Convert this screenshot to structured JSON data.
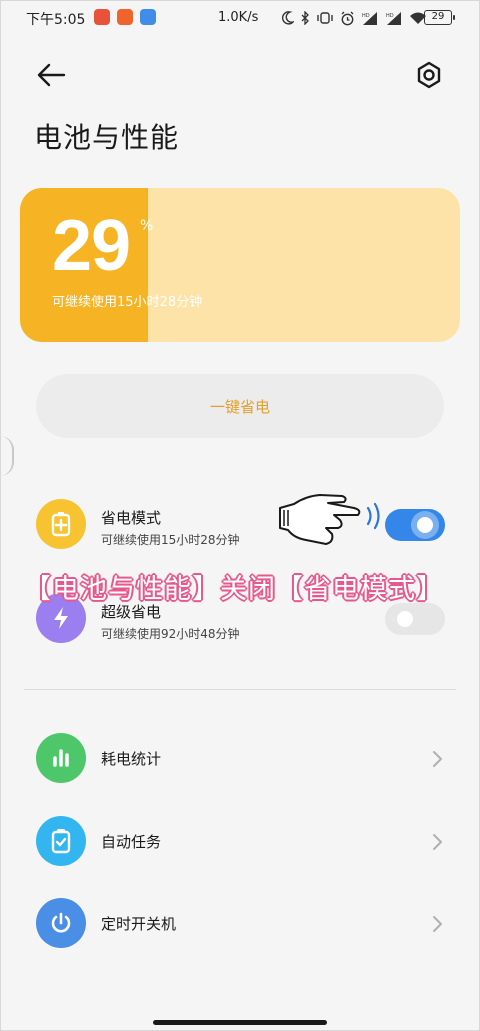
{
  "status_bar": {
    "time": "下午5:05",
    "net_speed": "1.0K/s",
    "battery_level": "29",
    "icons": [
      "moon-icon",
      "bluetooth-icon",
      "vibrate-icon",
      "alarm-icon",
      "signal-hd-icon",
      "signal-hd-icon",
      "wifi-icon"
    ]
  },
  "header": {
    "title": "电池与性能"
  },
  "battery_card": {
    "percent": "29",
    "unit": "%",
    "level_fraction": 0.29,
    "remaining": "可继续使用15小时28分钟"
  },
  "one_key_save": {
    "label": "一键省电"
  },
  "modes": [
    {
      "title": "省电模式",
      "subtitle": "可继续使用15小时28分钟",
      "enabled": true,
      "icon": "battery-plus-icon",
      "icon_color": "#f7c331"
    },
    {
      "title": "超级省电",
      "subtitle": "可继续使用92小时48分钟",
      "enabled": false,
      "icon": "lightning-icon",
      "icon_color": "#9b7ef0"
    }
  ],
  "menu": [
    {
      "title": "耗电统计",
      "icon": "bar-chart-icon",
      "icon_color": "#4dc76a"
    },
    {
      "title": "自动任务",
      "icon": "clipboard-check-icon",
      "icon_color": "#33b6ef"
    },
    {
      "title": "定时开关机",
      "icon": "power-icon",
      "icon_color": "#4a8ee6"
    }
  ],
  "overlay": {
    "caption": "【电池与性能】关闭【省电模式】"
  },
  "colors": {
    "accent_orange": "#f6b324",
    "card_bg": "#fde3a8",
    "toggle_on": "#3486e8",
    "caption_stroke": "#e65a8c"
  }
}
